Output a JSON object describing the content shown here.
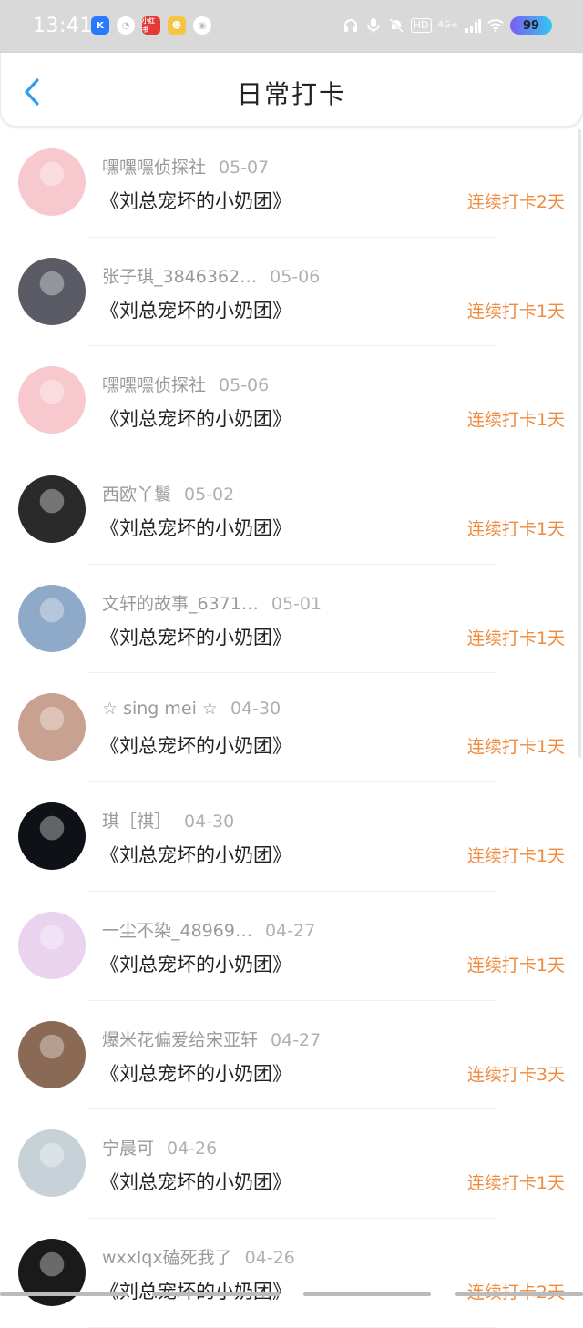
{
  "status_bar": {
    "time": "13:41",
    "apps": [
      {
        "icon": "kugou-app-icon",
        "label": "K",
        "color": "#2979ff"
      },
      {
        "icon": "compass-app-icon",
        "label": "◔",
        "color": "#bdbdbd"
      },
      {
        "icon": "xiaohongshu-app-icon",
        "label": "小红书",
        "color": "#e53935"
      },
      {
        "icon": "mascot-app-icon",
        "label": "☻",
        "color": "#f4c542"
      },
      {
        "icon": "cat-app-icon",
        "label": "◉",
        "color": "#bdbdbd"
      }
    ],
    "network": "4G+",
    "hd_badge": "HD",
    "battery": "99"
  },
  "header": {
    "title": "日常打卡"
  },
  "entries": [
    {
      "user": "嘿嘿嘿侦探社",
      "date": "05-07",
      "book": "《刘总宠坏的小奶团》",
      "streak": "连续打卡2天",
      "avatar": "#f7c9cf"
    },
    {
      "user": "张子琪_3846362…",
      "date": "05-06",
      "book": "《刘总宠坏的小奶团》",
      "streak": "连续打卡1天",
      "avatar": "#5b5b66"
    },
    {
      "user": "嘿嘿嘿侦探社",
      "date": "05-06",
      "book": "《刘总宠坏的小奶团》",
      "streak": "连续打卡1天",
      "avatar": "#f7c9cf"
    },
    {
      "user": "西欧丫鬟",
      "date": "05-02",
      "book": "《刘总宠坏的小奶团》",
      "streak": "连续打卡1天",
      "avatar": "#2a2a2a"
    },
    {
      "user": "文轩的故事_6371…",
      "date": "05-01",
      "book": "《刘总宠坏的小奶团》",
      "streak": "连续打卡1天",
      "avatar": "#8fa9c9"
    },
    {
      "user": "☆ sing mei ☆",
      "date": "04-30",
      "book": "《刘总宠坏的小奶团》",
      "streak": "连续打卡1天",
      "avatar": "#c9a190"
    },
    {
      "user": "琪［祺］",
      "date": "04-30",
      "book": "《刘总宠坏的小奶团》",
      "streak": "连续打卡1天",
      "avatar": "#0e1116"
    },
    {
      "user": "一尘不染_48969…",
      "date": "04-27",
      "book": "《刘总宠坏的小奶团》",
      "streak": "连续打卡1天",
      "avatar": "#e9d3ef"
    },
    {
      "user": "爆米花偏爱给宋亚轩",
      "date": "04-27",
      "book": "《刘总宠坏的小奶团》",
      "streak": "连续打卡3天",
      "avatar": "#8a6a55"
    },
    {
      "user": "宁晨可",
      "date": "04-26",
      "book": "《刘总宠坏的小奶团》",
      "streak": "连续打卡1天",
      "avatar": "#c7d2d8"
    },
    {
      "user": "wxxlqx磕死我了",
      "date": "04-26",
      "book": "《刘总宠坏的小奶团》",
      "streak": "连续打卡2天",
      "avatar": "#1a1a1a"
    }
  ]
}
